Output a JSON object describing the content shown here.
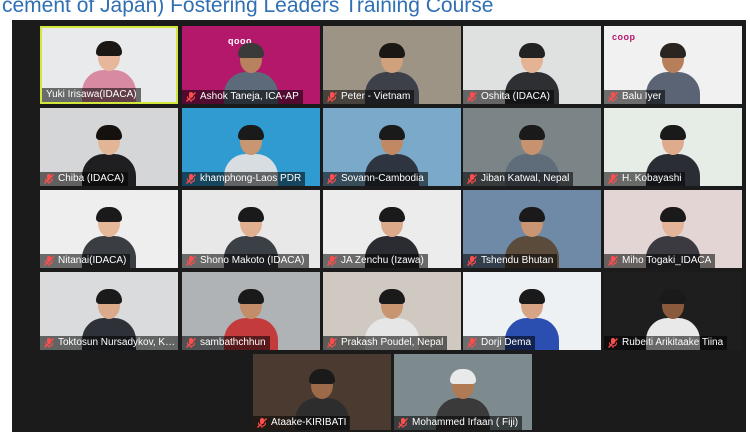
{
  "banner": {
    "title": "cement of Japan) Fostering Leaders Training Course"
  },
  "colors": {
    "active_border": "#d3e63a",
    "stage_bg": "#1b1b1b",
    "banner_text": "#2f6fb3"
  },
  "tiles": [
    {
      "name": "Yuki Irisawa(IDACA)",
      "active": true,
      "muted": false,
      "bg": "#e9eaec",
      "hair": "#1b1714",
      "skin": "#e6b79a",
      "shirt": "#d98aa3"
    },
    {
      "name": "Ashok Taneja, ICA-AP",
      "muted": true,
      "bg": "#b3186a",
      "hair": "#3a3a3a",
      "skin": "#b9825f",
      "shirt": "#5d6a7a",
      "logo": "qooo"
    },
    {
      "name": "Peter - Vietnam",
      "muted": true,
      "bg": "#9e9486",
      "hair": "#1b1714",
      "skin": "#d1a07c",
      "shirt": "#3d4048"
    },
    {
      "name": "Oshita (IDACA)",
      "muted": true,
      "bg": "#dfe0e0",
      "hair": "#222222",
      "skin": "#e3b394",
      "shirt": "#2d2f33"
    },
    {
      "name": "Balu Iyer",
      "muted": true,
      "bg": "#f1f1f2",
      "hair": "#2a2520",
      "skin": "#b77e5a",
      "shirt": "#5a6474",
      "logo": "coop"
    },
    {
      "name": "Chiba (IDACA)",
      "muted": true,
      "bg": "#d4d6d8",
      "hair": "#15110f",
      "skin": "#e2b597",
      "shirt": "#1f1f22"
    },
    {
      "name": "khamphong-Laos PDR",
      "muted": true,
      "bg": "#2f9bd1",
      "hair": "#1a1a1a",
      "skin": "#c89670",
      "shirt": "#d8dde2"
    },
    {
      "name": "Sovann-Cambodia",
      "muted": true,
      "bg": "#7aa9c9",
      "hair": "#1a1a1a",
      "skin": "#c08964",
      "shirt": "#2e3540"
    },
    {
      "name": "Jiban Katwal, Nepal",
      "muted": true,
      "bg": "#7b8486",
      "hair": "#1a1a1a",
      "skin": "#c79270",
      "shirt": "#5f6d7a"
    },
    {
      "name": "H. Kobayashi",
      "muted": true,
      "bg": "#e6ece6",
      "hair": "#1a1a1a",
      "skin": "#deac8c",
      "shirt": "#2a2d33"
    },
    {
      "name": "Nitanai(IDACA)",
      "muted": true,
      "bg": "#eeeeee",
      "hair": "#1a1a1a",
      "skin": "#e5b899",
      "shirt": "#3a3d42"
    },
    {
      "name": "Shono Makoto (IDACA)",
      "muted": true,
      "bg": "#e8e8e8",
      "hair": "#1a1a1a",
      "skin": "#e1b090",
      "shirt": "#3b3f46"
    },
    {
      "name": "JA Zenchu (Izawa)",
      "muted": true,
      "bg": "#ececec",
      "hair": "#1a1a1a",
      "skin": "#dca98a",
      "shirt": "#2a2c31"
    },
    {
      "name": "Tshendu Bhutan",
      "muted": true,
      "bg": "#6f8aa6",
      "hair": "#1a1a1a",
      "skin": "#c99573",
      "shirt": "#5a4b3b"
    },
    {
      "name": "Miho Togaki_IDACA",
      "muted": true,
      "bg": "#e3d5d3",
      "hair": "#1a1a1a",
      "skin": "#e3b497",
      "shirt": "#3a3a40"
    },
    {
      "name": "Toktosun Nursadykov, Kyr...",
      "muted": true,
      "bg": "#dadbdc",
      "hair": "#1a1a1a",
      "skin": "#dbaa8a",
      "shirt": "#2e3138"
    },
    {
      "name": "sambathchhun",
      "muted": true,
      "bg": "#b0b3b6",
      "hair": "#1a1a1a",
      "skin": "#c38d69",
      "shirt": "#c43b3b"
    },
    {
      "name": "Prakash Poudel, Nepal",
      "muted": true,
      "bg": "#cfc9c2",
      "hair": "#1a1a1a",
      "skin": "#c99470",
      "shirt": "#e6e6e6"
    },
    {
      "name": "Dorji Dema",
      "muted": true,
      "bg": "#eef1f4",
      "hair": "#1a1a1a",
      "skin": "#d7a585",
      "shirt": "#2b4fb0"
    },
    {
      "name": "Rubeiti Arikitaake Tiina",
      "muted": true,
      "bg": "#1e1e1e",
      "hair": "#1a1a1a",
      "skin": "#8a5a3c",
      "shirt": "#e9e9e9"
    },
    {
      "name": "Ataake-KIRIBATI",
      "muted": true,
      "bg": "#4a3a30",
      "hair": "#1a1a1a",
      "skin": "#9c6a48",
      "shirt": "#2d2d2d"
    },
    {
      "name": "Mohammed Irfaan ( Fiji)",
      "muted": true,
      "bg": "#7d8b8f",
      "hair": "#e9e9e9",
      "skin": "#b07a55",
      "shirt": "#3a3a3a"
    }
  ]
}
